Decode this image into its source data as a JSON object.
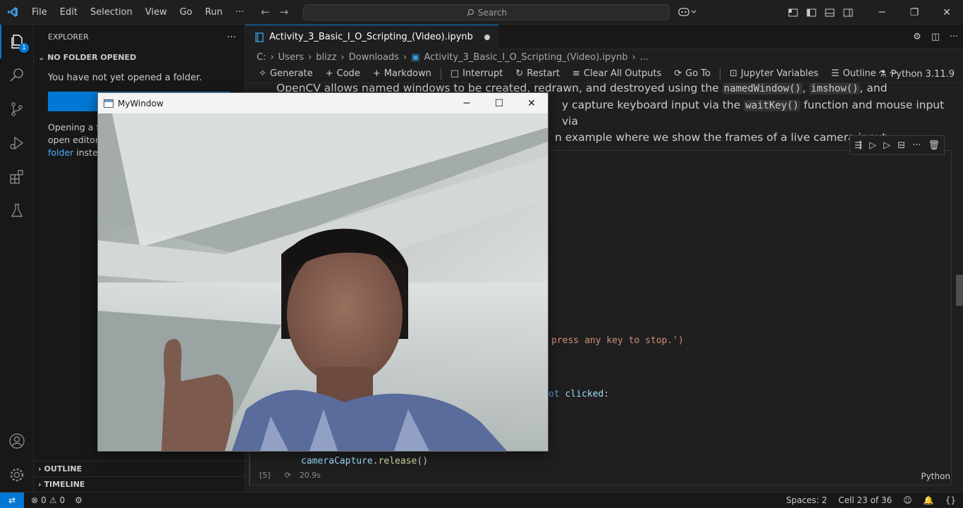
{
  "app": {
    "menu": [
      "File",
      "Edit",
      "Selection",
      "View",
      "Go",
      "Run",
      "···"
    ],
    "search_placeholder": "Search"
  },
  "activity": {
    "explorer_badge": "1"
  },
  "sidebar": {
    "title": "EXPLORER",
    "more": "···",
    "section": "NO FOLDER OPENED",
    "message": "You have not yet opened a folder.",
    "hint_part1": "Opening a f",
    "hint_part2": "open editor",
    "hint_link": "folder",
    "hint_part3": " instea",
    "outline": "OUTLINE",
    "timeline": "TIMELINE"
  },
  "editor": {
    "tab_title": "Activity_3_Basic_I_O_Scripting_(Video).ipynb",
    "breadcrumb": [
      "C:",
      "Users",
      "blizz",
      "Downloads",
      "Activity_3_Basic_I_O_Scripting_(Video).ipynb",
      "..."
    ],
    "toolbar": {
      "generate": "Generate",
      "code": "Code",
      "markdown": "Markdown",
      "interrupt": "Interrupt",
      "restart": "Restart",
      "clear_outputs": "Clear All Outputs",
      "goto": "Go To",
      "variables": "Jupyter Variables",
      "outline": "Outline",
      "more": "···",
      "kernel": "Python 3.11.9"
    },
    "markdown": {
      "line1_a": "OpenCV allows named windows to be created, redrawn, and destroyed using the ",
      "code1": "namedWindow()",
      "sep1": ", ",
      "code2": "imshow()",
      "line1_b": ", and",
      "line2_a": "y capture keyboard input via the ",
      "code3": "waitKey()",
      "line2_b": " function and mouse input via",
      "line3": "n example where we show the frames of a live camera input:"
    },
    "code": {
      "line_print_str": "press any key to stop.')",
      "line_while_kw": "ot",
      "line_while_var": "clicked",
      "line_while_end": ":",
      "line_release_obj": "cameraCapture",
      "line_release_fn": "release",
      "line_release_end": "()"
    },
    "exec_count": "[5]",
    "exec_time": "20.9s",
    "cell_language": "Python"
  },
  "cv_window": {
    "title": "MyWindow"
  },
  "status": {
    "errors": "0",
    "warnings": "0",
    "spaces": "Spaces: 2",
    "cell": "Cell 23 of 36",
    "braces": "{}"
  }
}
